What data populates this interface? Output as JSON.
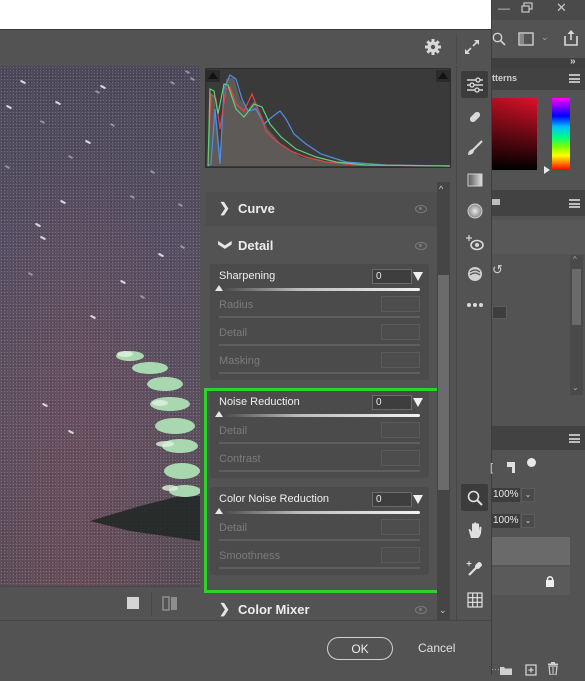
{
  "dialog": {
    "toolbar": {
      "settings_icon": "gear-icon",
      "fullscreen_icon": "expand-arrows-icon"
    },
    "panel": {
      "sections": [
        {
          "title": "Curve",
          "expanded": false
        },
        {
          "title": "Detail",
          "expanded": true
        },
        {
          "title": "Color Mixer",
          "expanded": false
        }
      ],
      "detail": {
        "groups": [
          {
            "title": "Sharpening",
            "value": "0",
            "slider_fraction": 0,
            "sub": [
              "Radius",
              "Detail",
              "Masking"
            ]
          },
          {
            "title": "Noise Reduction",
            "value": "0",
            "slider_fraction": 0,
            "sub": [
              "Detail",
              "Contrast"
            ]
          },
          {
            "title": "Color Noise Reduction",
            "value": "0",
            "slider_fraction": 0,
            "sub": [
              "Detail",
              "Smoothness"
            ]
          }
        ]
      },
      "highlight_color": "#2ed12e"
    },
    "tools": [
      "edit-sliders-icon",
      "healing-bandage-icon",
      "brush-icon",
      "gradient-filter-icon",
      "radial-filter-icon",
      "red-eye-icon",
      "presets-icon",
      "more-icon",
      "zoom-icon",
      "hand-icon",
      "white-balance-eyedropper-icon",
      "grid-icon"
    ],
    "footer": {
      "ok_label": "OK",
      "cancel_label": "Cancel"
    }
  },
  "photoshop": {
    "window_controls": [
      "minimize",
      "restore",
      "close"
    ],
    "panel_tab_partial": "tterns",
    "layers": {
      "opacity": "100%",
      "fill": "100%"
    }
  }
}
